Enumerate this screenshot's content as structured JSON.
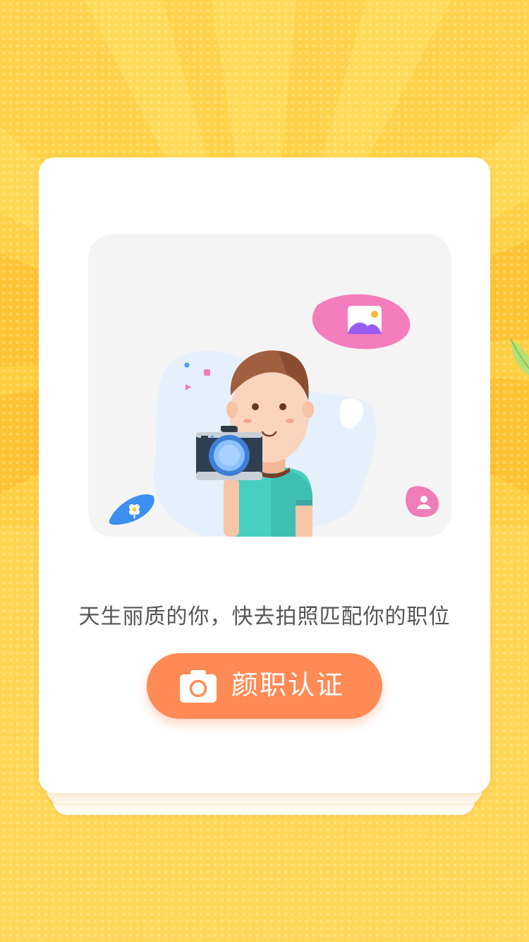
{
  "page": {
    "tagline": "天生丽质的你，快去拍照匹配你的职位",
    "primary_button": {
      "label": "颜职认证",
      "icon": "camera-icon"
    }
  },
  "illustration": {
    "subject": "man-with-camera",
    "bubbles": [
      "image-icon",
      "flower-icon",
      "person-icon"
    ]
  },
  "colors": {
    "background": "#ffd34d",
    "card": "#ffffff",
    "button": "#ff8a55",
    "text": "#555555"
  }
}
